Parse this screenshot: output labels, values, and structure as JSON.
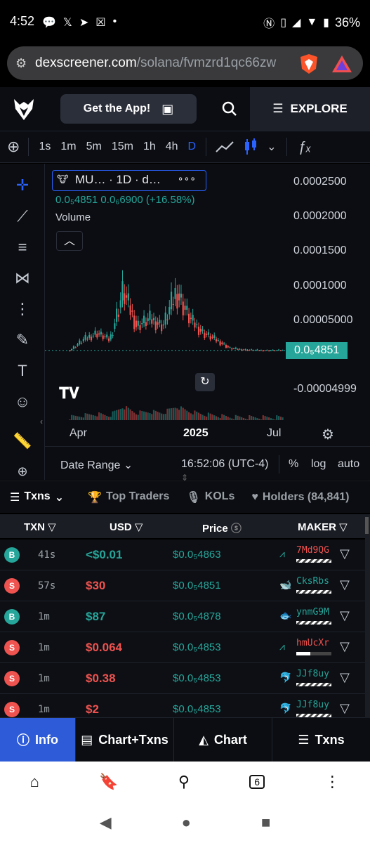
{
  "status": {
    "time": "4:52",
    "battery": "36%"
  },
  "browser": {
    "url_domain": "dexscreener.com",
    "url_path": "/solana/fvmzrd1qc66zw"
  },
  "header": {
    "get_app": "Get the App!",
    "explore": "EXPLORE"
  },
  "toolbar": {
    "timeframes": [
      "1s",
      "1m",
      "5m",
      "15m",
      "1h",
      "4h",
      "D"
    ],
    "active": "D"
  },
  "chart": {
    "legend_title": "MU… · 1D · d…",
    "legend_more": "∘∘∘",
    "info_line": "0.0₅4851  0.0₆6900 (+16.58%)",
    "volume_label": "Volume",
    "price_labels": [
      "0.0002500",
      "0.0002000",
      "0.0001500",
      "0.0001000",
      "0.00005000",
      "-0.00004999"
    ],
    "current_price": "0.0₅4851",
    "x_labels": [
      "Apr",
      "2025",
      "Jul"
    ],
    "date_range": "Date Range",
    "clock": "16:52:06 (UTC-4)",
    "percent": "%",
    "log": "log",
    "auto": "auto"
  },
  "chart_data": {
    "type": "candlestick",
    "x_labels": [
      "Apr",
      "2025",
      "Jul"
    ],
    "ylim": [
      -4.999e-05,
      0.00025
    ],
    "series": [
      {
        "values": [
          5e-06,
          2e-05,
          3e-05,
          2e-05,
          9e-05,
          4e-05,
          5e-05,
          4e-05,
          9e-05,
          5e-05,
          3e-05,
          2e-05,
          8e-06,
          6e-06,
          5e-06,
          4.8e-06,
          4.85e-06
        ]
      }
    ]
  },
  "tabs": [
    "Txns",
    "Top Traders",
    "KOLs",
    "Holders (84,841)"
  ],
  "table": {
    "headers": [
      "TXN",
      "USD",
      "Price",
      "MAKER"
    ],
    "rows": [
      {
        "type": "B",
        "age": "41s",
        "usd": "<$0.01",
        "price": "$0.0₅4863",
        "maker": "7Md9QG"
      },
      {
        "type": "S",
        "age": "57s",
        "usd": "$30",
        "price": "$0.0₅4851",
        "maker": "CksRbs"
      },
      {
        "type": "B",
        "age": "1m",
        "usd": "$87",
        "price": "$0.0₅4878",
        "maker": "ynmG9M"
      },
      {
        "type": "S",
        "age": "1m",
        "usd": "$0.064",
        "price": "$0.0₅4853",
        "maker": "hmUcXr"
      },
      {
        "type": "S",
        "age": "1m",
        "usd": "$0.38",
        "price": "$0.0₅4853",
        "maker": "JJf8uy"
      },
      {
        "type": "S",
        "age": "1m",
        "usd": "$2",
        "price": "$0.0₅4853",
        "maker": "JJf8uy"
      }
    ]
  },
  "bottom_nav": [
    "Info",
    "Chart+Txns",
    "Chart",
    "Txns"
  ],
  "browser_nav": {
    "tabs_count": "6"
  },
  "colors": {
    "buy": "#26a69a",
    "sell": "#ef5350",
    "accent": "#2962ff"
  }
}
